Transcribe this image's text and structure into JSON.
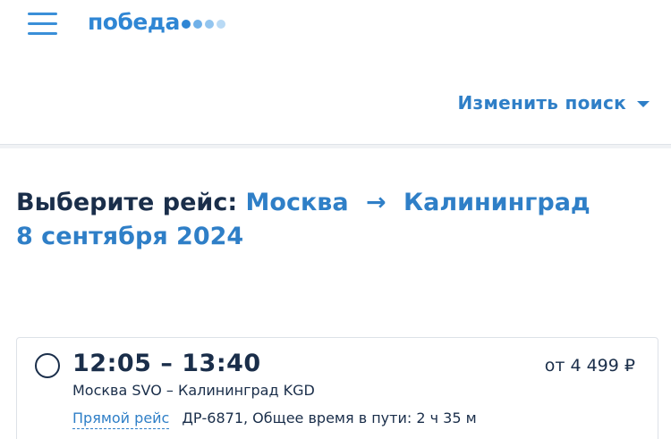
{
  "header": {
    "logo_text": "победа",
    "logo_dots": [
      "#2f86d4",
      "#6fb0e8",
      "#93c5ef",
      "#b9daf5"
    ]
  },
  "search": {
    "change_label": "Изменить поиск"
  },
  "title": {
    "prefix": "Выберите рейс:",
    "origin": "Москва",
    "arrow": "→",
    "destination": "Калининград",
    "date": "8 сентября 2024"
  },
  "flights": [
    {
      "time": "12:05 – 13:40",
      "price": "от 4 499 ₽",
      "route": "Москва SVO – Калининград KGD",
      "direct_label": "Прямой рейс",
      "info": "ДР-6871, Общее время в пути: 2 ч 35 м"
    }
  ],
  "colors": {
    "brand": "#2f86d4",
    "link": "#2f7fc7",
    "text": "#1a2e4a"
  }
}
